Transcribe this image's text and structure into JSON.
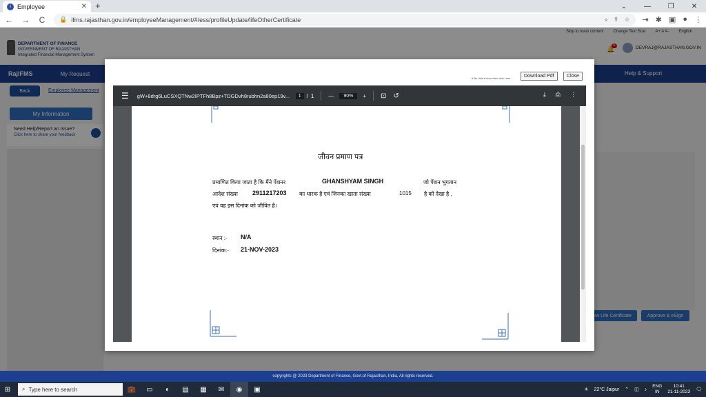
{
  "browser": {
    "tab_title": "Employee",
    "tab_favicon": "i",
    "url": "ifms.rajasthan.gov.in/employeeManagement/#/ess/profileUpdate/lifeOtherCertificate",
    "back_icon": "←",
    "forward_icon": "→",
    "reload_icon": "C",
    "newtab_icon": "+",
    "min_icon": "—",
    "max_icon": "❐",
    "close_icon": "✕",
    "chevron_icon": "⌄"
  },
  "site": {
    "utilbar": [
      "Skip to main content",
      "Change Text Size",
      "A+  A  A-",
      "English"
    ],
    "dept_title": "DEPARTMENT OF FINANCE",
    "dept_sub": "GOVERNMENT OF RAJASTHAN",
    "dept_sub2": "Integrated Financial Management System",
    "notif_count": "10",
    "user_email": "DEVRAJ@RAJASTHAN.GOV.IN",
    "brand": "RajIFMS",
    "nav_item": "My Request",
    "help": "Help & Support",
    "back_label": "Back",
    "crumb": "Employee Management",
    "my_information": "My Information",
    "help_title": "Need Help/Report an Issue?",
    "help_link": "Click here to share your feedback",
    "btn_view": "View Life Certificate",
    "btn_approve": "Approve & eSign",
    "footer": "copyrights @ 2023 Department of Finance, Govt.of Rajasthan, India, All rights reserved."
  },
  "modal": {
    "hint": "If file didn't show then click here",
    "download_label": "Download Pdf",
    "close_label": "Close"
  },
  "viewer": {
    "filename": "gW+8drg6LuCSXQTNw2IPTFh8Bpz+TDGDvh8rubhn2a80ep19v...",
    "page_current": "1",
    "page_sep": "/",
    "page_total": "1",
    "zoom": "90%",
    "minus": "—",
    "plus": "+"
  },
  "document": {
    "title": "जीवन प्रमाण पत्र",
    "l1a": "प्रमाणित किया जाता है कि मैंने पेंशनर",
    "pensioner_name": "GHANSHYAM SINGH",
    "l1b": "जो पेंशन भुगतान",
    "l2a": "आदेश संख्या",
    "ppo_number": "2911217203",
    "l2b": "का धारक है एवं जिनका खाता संख्या",
    "account_no": "1015",
    "l2c": "है को देखा है ,",
    "l3": "एवं वह इस दिनांक को जीवित है।",
    "place_label": "स्थान :-",
    "place_value": "N/A",
    "date_label": "दिनांक:-",
    "date_value": "21-NOV-2023"
  },
  "taskbar": {
    "search_placeholder": "Type here to search",
    "weather": "22°C  Jaipur",
    "lang": "ENG",
    "region": "IN",
    "time": "10:41",
    "date": "21-11-2023"
  },
  "colors": {
    "navbar": "#1d3f8f",
    "accent": "#2f6ebd",
    "viewer_bar": "#323639"
  }
}
